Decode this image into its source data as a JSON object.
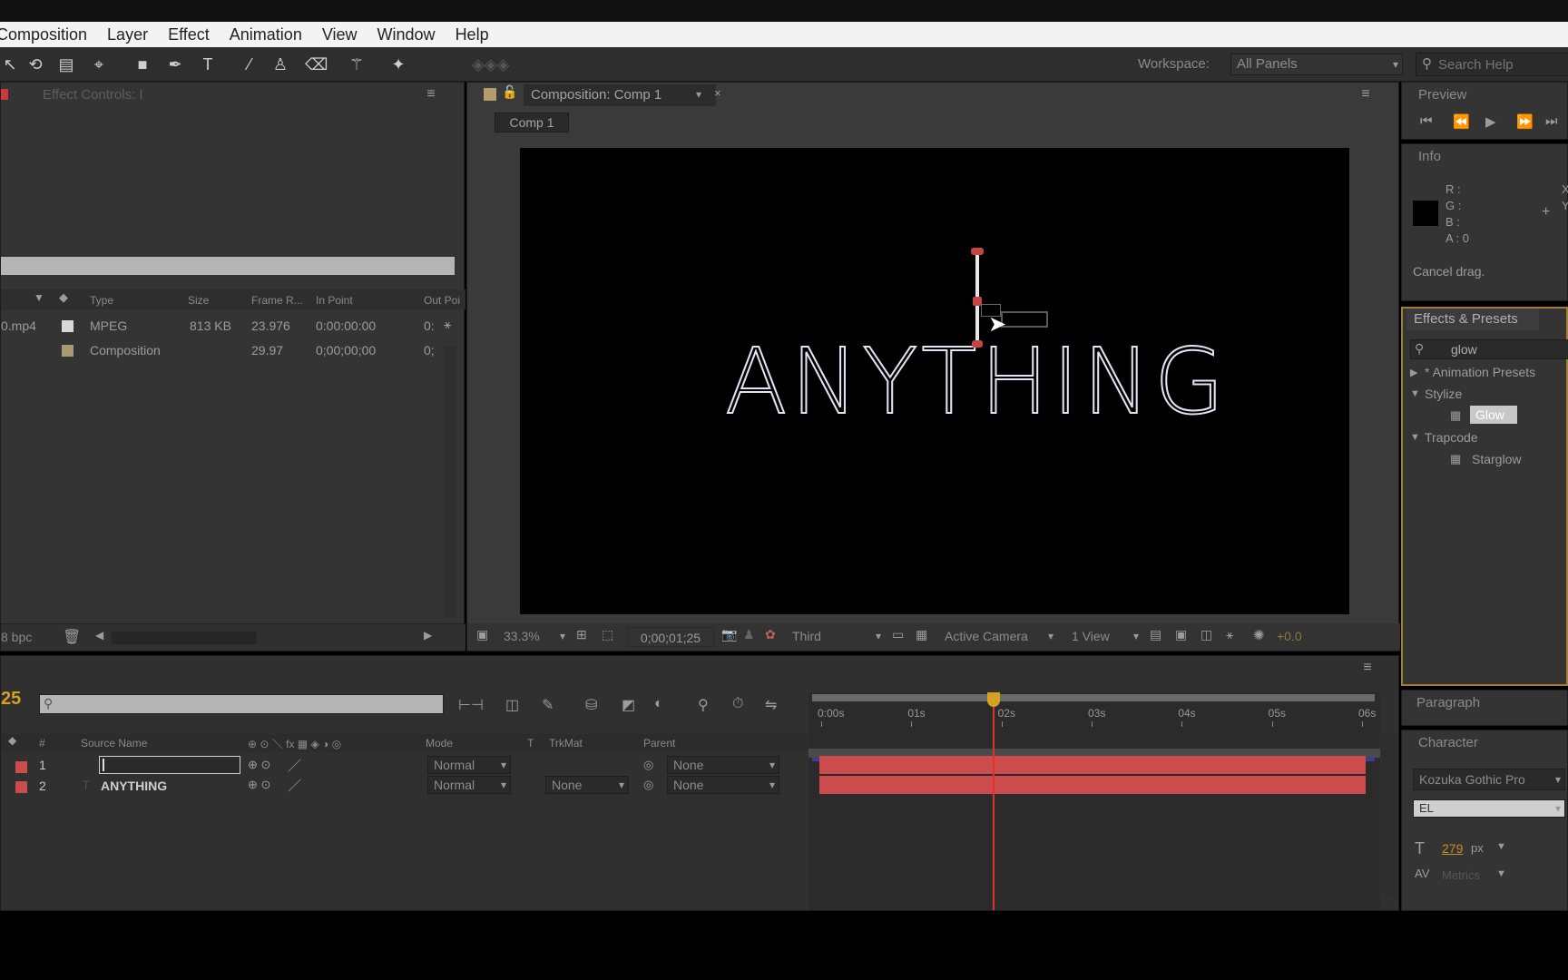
{
  "menu": {
    "items": [
      "Composition",
      "Layer",
      "Effect",
      "Animation",
      "View",
      "Window",
      "Help"
    ]
  },
  "workspace": {
    "label": "Workspace:",
    "value": "All Panels"
  },
  "search_help": {
    "placeholder": "Search Help"
  },
  "effect_controls": {
    "tab": "Effect Controls: I"
  },
  "project": {
    "columns": [
      "Type",
      "Size",
      "Frame R...",
      "In Point",
      "Out Poi"
    ],
    "rows": [
      {
        "name": "0.mp4",
        "type": "MPEG",
        "size": "813 KB",
        "frame_rate": "23.976",
        "in_point": "0:00:00:00",
        "out_point": "0:",
        "color": "#d9d9d9"
      },
      {
        "name": "",
        "type": "Composition",
        "size": "",
        "frame_rate": "29.97",
        "in_point": "0;00;00;00",
        "out_point": "0;",
        "color": "#a99a74"
      }
    ],
    "bpc": "8 bpc"
  },
  "composition": {
    "tab": "Composition: Comp 1",
    "subtab": "Comp 1",
    "text": "ANYTHING",
    "zoom": "33.3%",
    "timecode": "0;00;01;25",
    "view_layout": "Third",
    "camera": "Active Camera",
    "views": "1 View",
    "exposure": "+0.0"
  },
  "preview": {
    "tab": "Preview"
  },
  "info": {
    "tab": "Info",
    "r": "R :",
    "g": "G :",
    "b": "B :",
    "a": "A : 0",
    "x": "X",
    "y": "Y",
    "status": "Cancel drag."
  },
  "effects_presets": {
    "tab": "Effects & Presets",
    "search": "glow",
    "tree": [
      {
        "label": "* Animation Presets",
        "expanded": false
      },
      {
        "label": "Stylize",
        "expanded": true,
        "children": [
          "Glow"
        ]
      },
      {
        "label": "Trapcode",
        "expanded": true,
        "children": [
          "Starglow"
        ]
      }
    ]
  },
  "paragraph": {
    "tab": "Paragraph"
  },
  "character": {
    "tab": "Character",
    "font": "Kozuka Gothic Pro",
    "style": "EL",
    "size": "279",
    "size_unit": "px",
    "tracking": "Metrics"
  },
  "timeline": {
    "timecode": "25",
    "columns": [
      "#",
      "Source Name",
      "Mode",
      "T",
      "TrkMat",
      "Parent"
    ],
    "layers": [
      {
        "num": "1",
        "name": "",
        "mode": "Normal",
        "trkmat": "",
        "parent": "None",
        "label_color": "#cc4b4b",
        "editing": true
      },
      {
        "num": "2",
        "name": "ANYTHING",
        "mode": "Normal",
        "trkmat": "None",
        "parent": "None",
        "label_color": "#cc4b4b",
        "editing": false
      }
    ],
    "ruler": [
      "0:00s",
      "01s",
      "02s",
      "03s",
      "04s",
      "05s",
      "06s"
    ],
    "playhead_time_s": 1.9
  }
}
